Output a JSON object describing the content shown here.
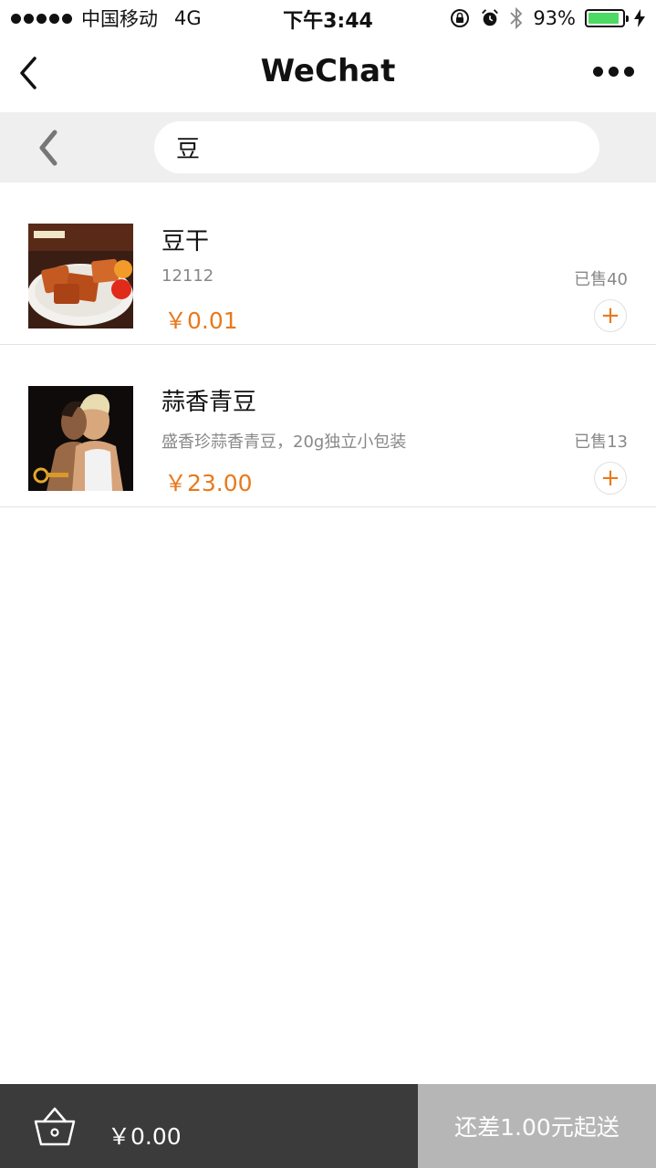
{
  "status_bar": {
    "carrier": "中国移动",
    "network": "4G",
    "time": "下午3:44",
    "battery": "93%",
    "battery_level": 0.93
  },
  "nav": {
    "title": "WeChat"
  },
  "search": {
    "value": "豆"
  },
  "products": [
    {
      "name": "豆干",
      "description": "12112",
      "sold": "已售40",
      "price": "￥0.01"
    },
    {
      "name": "蒜香青豆",
      "description": "盛香珍蒜香青豆，20g独立小包装",
      "sold": "已售13",
      "price": "￥23.00"
    }
  ],
  "cart": {
    "total": "￥0.00",
    "checkout_label": "还差1.00元起送"
  },
  "colors": {
    "accent": "#e8791c",
    "cart_bar": "#3b3b3b",
    "checkout_disabled": "#b6b6b6",
    "search_bg": "#efefef"
  },
  "icons": [
    "back-chevron-icon",
    "more-dots-icon",
    "plus-icon",
    "basket-icon",
    "alarm-icon",
    "bluetooth-icon",
    "rotation-lock-icon",
    "charging-icon"
  ]
}
